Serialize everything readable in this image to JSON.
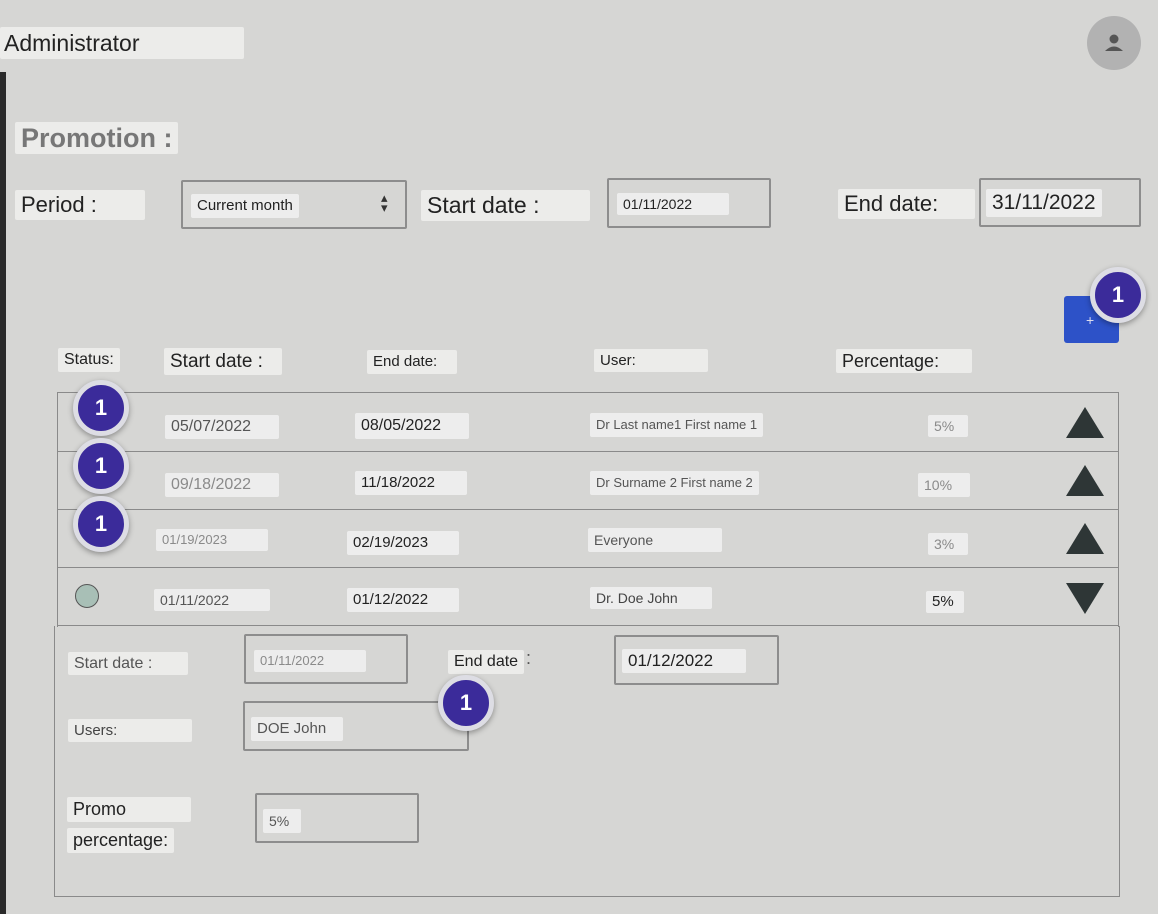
{
  "header": {
    "title": "Administrator",
    "avatar_icon": "user-icon"
  },
  "promotion": {
    "heading": "Promotion :",
    "period_label": "Period :",
    "period_value": "Current month",
    "start_label": "Start date :",
    "start_value": "01/11/2022",
    "end_label": "End date:",
    "end_value": "31/11/2022"
  },
  "add_button": {
    "icon": "plus-icon",
    "label": "+"
  },
  "badge_text": "1",
  "table": {
    "headers": {
      "status": "Status:",
      "start": "Start date :",
      "end": "End date:",
      "user": "User:",
      "percentage": "Percentage:"
    },
    "rows": [
      {
        "start": "05/07/2022",
        "end": "08/05/2022",
        "user": "Dr Last name1 First name 1",
        "percentage": "5%",
        "expanded": false
      },
      {
        "start": "09/18/2022",
        "end": "11/18/2022",
        "user": "Dr Surname 2 First name 2",
        "percentage": "10%",
        "expanded": false
      },
      {
        "start": "01/19/2023",
        "end": "02/19/2023",
        "user": "Everyone",
        "percentage": "3%",
        "expanded": false
      },
      {
        "start": "01/11/2022",
        "end": "01/12/2022",
        "user": "Dr. Doe John",
        "percentage": "5%",
        "expanded": true
      }
    ]
  },
  "detail": {
    "start_label": "Start date :",
    "start_value": "01/11/2022",
    "end_label": "End date",
    "end_value": "01/12/2022",
    "users_label": "Users:",
    "users_value": "DOE John",
    "promo_label_1": "Promo",
    "promo_label_2": "percentage:",
    "promo_value": "5%"
  },
  "colors": {
    "badge": "#3b2b9a",
    "add_button": "#2d52c8",
    "arrow": "#2e3636",
    "background": "#d6d6d4"
  }
}
